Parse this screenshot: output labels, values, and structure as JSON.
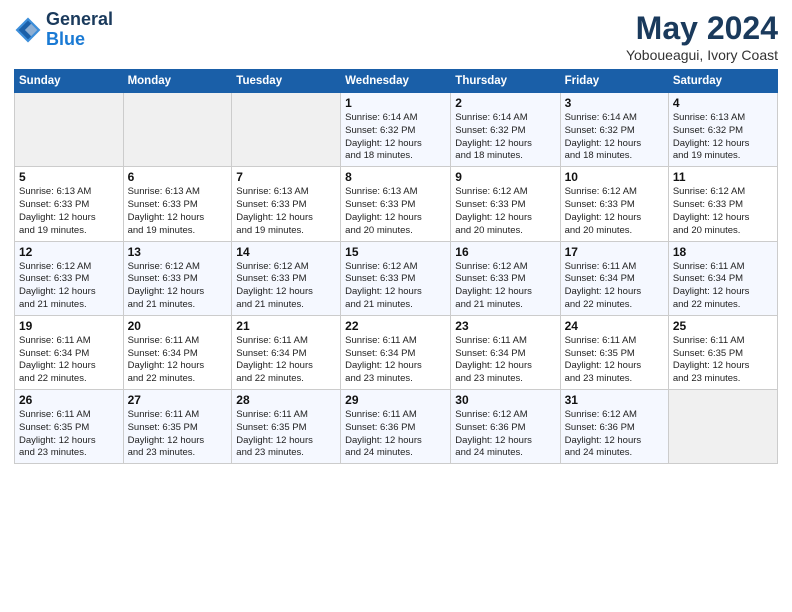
{
  "logo": {
    "text_general": "General",
    "text_blue": "Blue"
  },
  "header": {
    "title": "May 2024",
    "subtitle": "Yoboueagui, Ivory Coast"
  },
  "weekdays": [
    "Sunday",
    "Monday",
    "Tuesday",
    "Wednesday",
    "Thursday",
    "Friday",
    "Saturday"
  ],
  "weeks": [
    [
      {
        "day": "",
        "info": ""
      },
      {
        "day": "",
        "info": ""
      },
      {
        "day": "",
        "info": ""
      },
      {
        "day": "1",
        "info": "Sunrise: 6:14 AM\nSunset: 6:32 PM\nDaylight: 12 hours\nand 18 minutes."
      },
      {
        "day": "2",
        "info": "Sunrise: 6:14 AM\nSunset: 6:32 PM\nDaylight: 12 hours\nand 18 minutes."
      },
      {
        "day": "3",
        "info": "Sunrise: 6:14 AM\nSunset: 6:32 PM\nDaylight: 12 hours\nand 18 minutes."
      },
      {
        "day": "4",
        "info": "Sunrise: 6:13 AM\nSunset: 6:32 PM\nDaylight: 12 hours\nand 19 minutes."
      }
    ],
    [
      {
        "day": "5",
        "info": "Sunrise: 6:13 AM\nSunset: 6:33 PM\nDaylight: 12 hours\nand 19 minutes."
      },
      {
        "day": "6",
        "info": "Sunrise: 6:13 AM\nSunset: 6:33 PM\nDaylight: 12 hours\nand 19 minutes."
      },
      {
        "day": "7",
        "info": "Sunrise: 6:13 AM\nSunset: 6:33 PM\nDaylight: 12 hours\nand 19 minutes."
      },
      {
        "day": "8",
        "info": "Sunrise: 6:13 AM\nSunset: 6:33 PM\nDaylight: 12 hours\nand 20 minutes."
      },
      {
        "day": "9",
        "info": "Sunrise: 6:12 AM\nSunset: 6:33 PM\nDaylight: 12 hours\nand 20 minutes."
      },
      {
        "day": "10",
        "info": "Sunrise: 6:12 AM\nSunset: 6:33 PM\nDaylight: 12 hours\nand 20 minutes."
      },
      {
        "day": "11",
        "info": "Sunrise: 6:12 AM\nSunset: 6:33 PM\nDaylight: 12 hours\nand 20 minutes."
      }
    ],
    [
      {
        "day": "12",
        "info": "Sunrise: 6:12 AM\nSunset: 6:33 PM\nDaylight: 12 hours\nand 21 minutes."
      },
      {
        "day": "13",
        "info": "Sunrise: 6:12 AM\nSunset: 6:33 PM\nDaylight: 12 hours\nand 21 minutes."
      },
      {
        "day": "14",
        "info": "Sunrise: 6:12 AM\nSunset: 6:33 PM\nDaylight: 12 hours\nand 21 minutes."
      },
      {
        "day": "15",
        "info": "Sunrise: 6:12 AM\nSunset: 6:33 PM\nDaylight: 12 hours\nand 21 minutes."
      },
      {
        "day": "16",
        "info": "Sunrise: 6:12 AM\nSunset: 6:33 PM\nDaylight: 12 hours\nand 21 minutes."
      },
      {
        "day": "17",
        "info": "Sunrise: 6:11 AM\nSunset: 6:34 PM\nDaylight: 12 hours\nand 22 minutes."
      },
      {
        "day": "18",
        "info": "Sunrise: 6:11 AM\nSunset: 6:34 PM\nDaylight: 12 hours\nand 22 minutes."
      }
    ],
    [
      {
        "day": "19",
        "info": "Sunrise: 6:11 AM\nSunset: 6:34 PM\nDaylight: 12 hours\nand 22 minutes."
      },
      {
        "day": "20",
        "info": "Sunrise: 6:11 AM\nSunset: 6:34 PM\nDaylight: 12 hours\nand 22 minutes."
      },
      {
        "day": "21",
        "info": "Sunrise: 6:11 AM\nSunset: 6:34 PM\nDaylight: 12 hours\nand 22 minutes."
      },
      {
        "day": "22",
        "info": "Sunrise: 6:11 AM\nSunset: 6:34 PM\nDaylight: 12 hours\nand 23 minutes."
      },
      {
        "day": "23",
        "info": "Sunrise: 6:11 AM\nSunset: 6:34 PM\nDaylight: 12 hours\nand 23 minutes."
      },
      {
        "day": "24",
        "info": "Sunrise: 6:11 AM\nSunset: 6:35 PM\nDaylight: 12 hours\nand 23 minutes."
      },
      {
        "day": "25",
        "info": "Sunrise: 6:11 AM\nSunset: 6:35 PM\nDaylight: 12 hours\nand 23 minutes."
      }
    ],
    [
      {
        "day": "26",
        "info": "Sunrise: 6:11 AM\nSunset: 6:35 PM\nDaylight: 12 hours\nand 23 minutes."
      },
      {
        "day": "27",
        "info": "Sunrise: 6:11 AM\nSunset: 6:35 PM\nDaylight: 12 hours\nand 23 minutes."
      },
      {
        "day": "28",
        "info": "Sunrise: 6:11 AM\nSunset: 6:35 PM\nDaylight: 12 hours\nand 23 minutes."
      },
      {
        "day": "29",
        "info": "Sunrise: 6:11 AM\nSunset: 6:36 PM\nDaylight: 12 hours\nand 24 minutes."
      },
      {
        "day": "30",
        "info": "Sunrise: 6:12 AM\nSunset: 6:36 PM\nDaylight: 12 hours\nand 24 minutes."
      },
      {
        "day": "31",
        "info": "Sunrise: 6:12 AM\nSunset: 6:36 PM\nDaylight: 12 hours\nand 24 minutes."
      },
      {
        "day": "",
        "info": ""
      }
    ]
  ]
}
